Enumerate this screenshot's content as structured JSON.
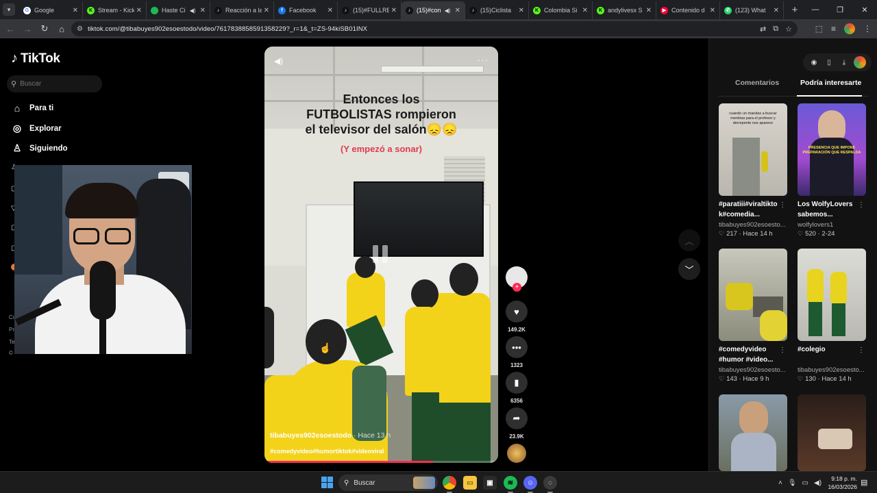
{
  "browser": {
    "tabs": [
      {
        "title": "Google",
        "fav": "G",
        "color": "#4285f4",
        "bg": "#fff",
        "active": false,
        "sound": false
      },
      {
        "title": "Stream - Kick",
        "fav": "K",
        "color": "#000",
        "bg": "#53fc18",
        "active": false,
        "sound": false
      },
      {
        "title": "Haste Ci",
        "fav": "",
        "color": "#fff",
        "bg": "#1db954",
        "active": false,
        "sound": true
      },
      {
        "title": "Reacción a la",
        "fav": "♪",
        "color": "#fff",
        "bg": "#111",
        "active": false,
        "sound": false
      },
      {
        "title": "Facebook",
        "fav": "f",
        "color": "#fff",
        "bg": "#1877f2",
        "active": false,
        "sound": false
      },
      {
        "title": "(15)#FULLRE",
        "fav": "♪",
        "color": "#fff",
        "bg": "#111",
        "active": false,
        "sound": false
      },
      {
        "title": "(15)#con",
        "fav": "♪",
        "color": "#fff",
        "bg": "#111",
        "active": true,
        "sound": true
      },
      {
        "title": "(15)Ciclista",
        "fav": "♪",
        "color": "#fff",
        "bg": "#111",
        "active": false,
        "sound": false
      },
      {
        "title": "Colombia Si",
        "fav": "K",
        "color": "#000",
        "bg": "#53fc18",
        "active": false,
        "sound": false
      },
      {
        "title": "andylivesx S",
        "fav": "K",
        "color": "#000",
        "bg": "#53fc18",
        "active": false,
        "sound": false
      },
      {
        "title": "Contenido d",
        "fav": "▶",
        "color": "#fff",
        "bg": "#ff0033",
        "active": false,
        "sound": false
      },
      {
        "title": "(123) What",
        "fav": "✆",
        "color": "#fff",
        "bg": "#25d366",
        "active": false,
        "sound": false
      }
    ],
    "url": "tiktok.com/@tibabuyes902esoestodo/video/7617838858591358229?_r=1&_t=ZS-94kiSB01INX"
  },
  "sidebar": {
    "logo_text": "TikTok",
    "search_placeholder": "Buscar",
    "items": [
      {
        "label": "Para ti",
        "icon": "⌂"
      },
      {
        "label": "Explorar",
        "icon": "◎"
      },
      {
        "label": "Siguiendo",
        "icon": "♙"
      }
    ],
    "footer_texts": [
      "Co",
      "Pr",
      "Te",
      "©"
    ]
  },
  "video": {
    "caption_line1": "Entonces los",
    "caption_line2": "FUTBOLISTAS rompieron",
    "caption_line3": "el televisor del salón😞😞",
    "caption_sub": "(Y empezó a sonar)",
    "author": "tibabuyes902esoestodo",
    "time": "· Hace 13 h",
    "hashtags": "#comedyvideo#humortiktok#videoviral",
    "progress": 0.72
  },
  "actions": {
    "likes": "149.2K",
    "comments": "1323",
    "saves": "6356",
    "shares": "23.9K"
  },
  "rightpanel": {
    "tab_comments": "Comentarios",
    "tab_suggested": "Podría interesarte",
    "cards": [
      {
        "title": "#paratiii#viraltikto\nk#comedia...",
        "author": "tibabuyes902esoesto...",
        "likes": "217",
        "age": "Hace 14 h",
        "thumb_text": "cuando un mandas a buscar mentiras para el profesor y derrepente nos aparece"
      },
      {
        "title": "Los WolfyLovers\nsabemos...",
        "author": "wolfylovers1",
        "likes": "520",
        "age": "2-24",
        "thumb_text": "PRESENCIA QUE IMPONE PREPARACIÓN QUE RESPALDA"
      },
      {
        "title": "#comedyvideo\n#humor #video...",
        "author": "tibabuyes902esoesto...",
        "likes": "143",
        "age": "Hace 9 h",
        "thumb_text": ""
      },
      {
        "title": "#colegio",
        "author": "tibabuyes902esoesto...",
        "likes": "130",
        "age": "Hace 14 h",
        "thumb_text": ""
      },
      {
        "title": "",
        "author": "",
        "likes": "",
        "age": "",
        "thumb_text": ""
      },
      {
        "title": "",
        "author": "",
        "likes": "",
        "age": "",
        "thumb_text": ""
      }
    ]
  },
  "taskbar": {
    "search_label": "Buscar",
    "time": "9:18 p. m.",
    "date": "16/03/2026"
  }
}
